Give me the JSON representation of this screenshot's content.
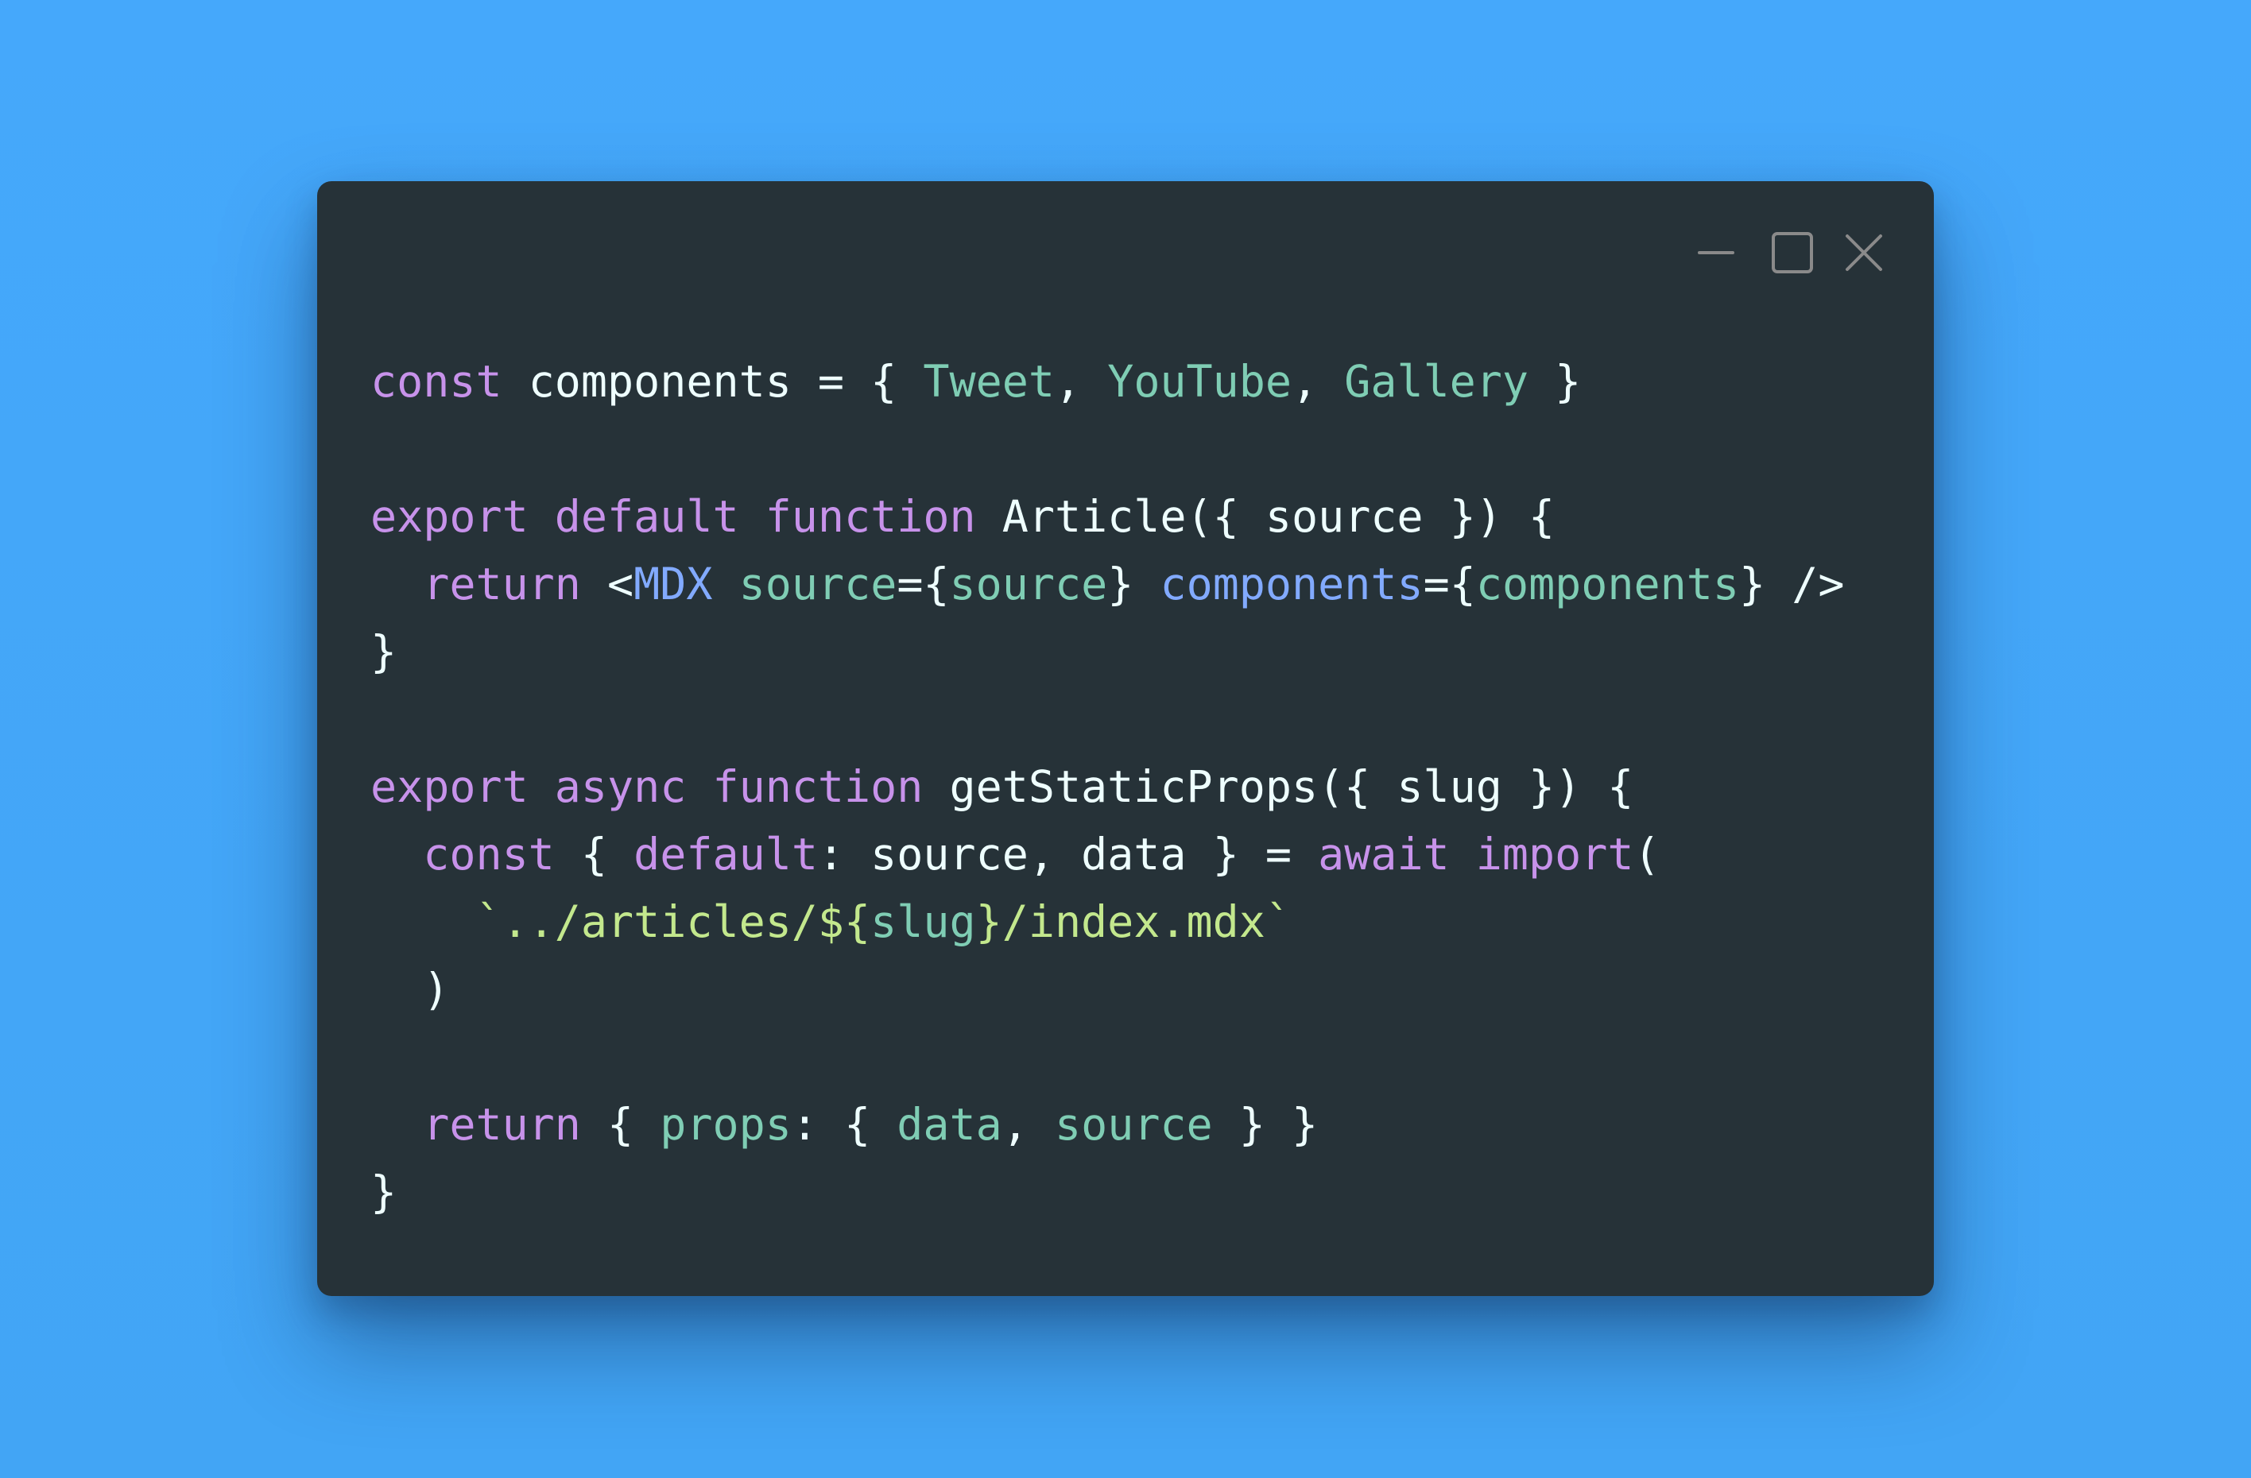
{
  "colors": {
    "background": "#42a5f5",
    "window": "#263238",
    "keyword": "#c792ea",
    "identifier": "#eeffff",
    "component": "#7fcdb4",
    "tag": "#82aaff",
    "string": "#c3e88d",
    "controls": "#8a8a8a"
  },
  "window_controls": {
    "minimize": "minimize-icon",
    "maximize": "maximize-icon",
    "close": "close-icon"
  },
  "code": {
    "lines": [
      {
        "tokens": [
          [
            "kw",
            "const"
          ],
          [
            "id",
            " components = { "
          ],
          [
            "comp",
            "Tweet"
          ],
          [
            "id",
            ", "
          ],
          [
            "comp",
            "YouTube"
          ],
          [
            "id",
            ", "
          ],
          [
            "comp",
            "Gallery"
          ],
          [
            "id",
            " }"
          ]
        ]
      },
      {
        "tokens": []
      },
      {
        "tokens": [
          [
            "kw",
            "export default function"
          ],
          [
            "id",
            " Article({ source }) {"
          ]
        ]
      },
      {
        "tokens": [
          [
            "id",
            "  "
          ],
          [
            "kw",
            "return"
          ],
          [
            "id",
            " <"
          ],
          [
            "tag",
            "MDX"
          ],
          [
            "id",
            " "
          ],
          [
            "prop",
            "source"
          ],
          [
            "id",
            "={"
          ],
          [
            "prop",
            "source"
          ],
          [
            "id",
            "} "
          ],
          [
            "attr",
            "components"
          ],
          [
            "id",
            "={"
          ],
          [
            "prop",
            "components"
          ],
          [
            "id",
            "} />"
          ]
        ]
      },
      {
        "tokens": [
          [
            "id",
            "}"
          ]
        ]
      },
      {
        "tokens": []
      },
      {
        "tokens": [
          [
            "kw",
            "export async function"
          ],
          [
            "id",
            " getStaticProps({ slug }) {"
          ]
        ]
      },
      {
        "tokens": [
          [
            "id",
            "  "
          ],
          [
            "kw",
            "const"
          ],
          [
            "id",
            " { "
          ],
          [
            "kw",
            "default"
          ],
          [
            "id",
            ": source, data } = "
          ],
          [
            "kw",
            "await import"
          ],
          [
            "id",
            "("
          ]
        ]
      },
      {
        "tokens": [
          [
            "id",
            "    "
          ],
          [
            "str",
            "`../articles/${"
          ],
          [
            "prop",
            "slug"
          ],
          [
            "str",
            "}/index.mdx`"
          ]
        ]
      },
      {
        "tokens": [
          [
            "id",
            "  )"
          ]
        ]
      },
      {
        "tokens": []
      },
      {
        "tokens": [
          [
            "id",
            "  "
          ],
          [
            "kw",
            "return"
          ],
          [
            "id",
            " { "
          ],
          [
            "prop",
            "props"
          ],
          [
            "id",
            ": { "
          ],
          [
            "prop",
            "data"
          ],
          [
            "id",
            ", "
          ],
          [
            "prop",
            "source"
          ],
          [
            "id",
            " } }"
          ]
        ]
      },
      {
        "tokens": [
          [
            "id",
            "}"
          ]
        ]
      }
    ]
  }
}
